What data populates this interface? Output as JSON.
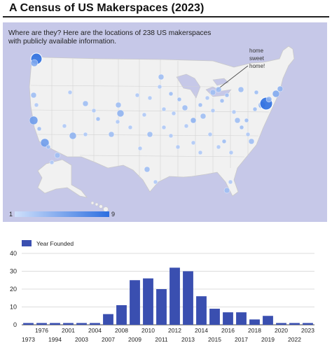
{
  "page": {
    "title": "A Census of US Makerspaces (2023)"
  },
  "map": {
    "caption": "Where are they? Here are the locations of 238 US makerspaces with publicly available information.",
    "annotation_lines": [
      "home",
      "sweet",
      "home!"
    ],
    "legend_min": "1",
    "legend_max": "9",
    "colors": {
      "background": "#c6c8e8",
      "land": "#f1f1f1",
      "border": "#c9c9c9",
      "dot_low": "#cfe0fb",
      "dot_high": "#2e6fe0"
    }
  },
  "chart_data": {
    "type": "bar",
    "legend": "Year Founded",
    "legend_position": "top-left",
    "categories": [
      "1973",
      "1976",
      "1994",
      "2001",
      "2003",
      "2004",
      "2007",
      "2008",
      "2009",
      "2010",
      "2011",
      "2012",
      "2013",
      "2014",
      "2015",
      "2016",
      "2017",
      "2018",
      "2019",
      "2020",
      "2022",
      "2023"
    ],
    "values": [
      1,
      1,
      1,
      1,
      1,
      1,
      6,
      11,
      25,
      26,
      20,
      32,
      30,
      16,
      9,
      7,
      7,
      3,
      5,
      1,
      1,
      1
    ],
    "ylim": [
      0,
      40
    ],
    "yticks": [
      0,
      10,
      20,
      30,
      40
    ],
    "grid": true,
    "bar_color": "#3a4fb0"
  }
}
